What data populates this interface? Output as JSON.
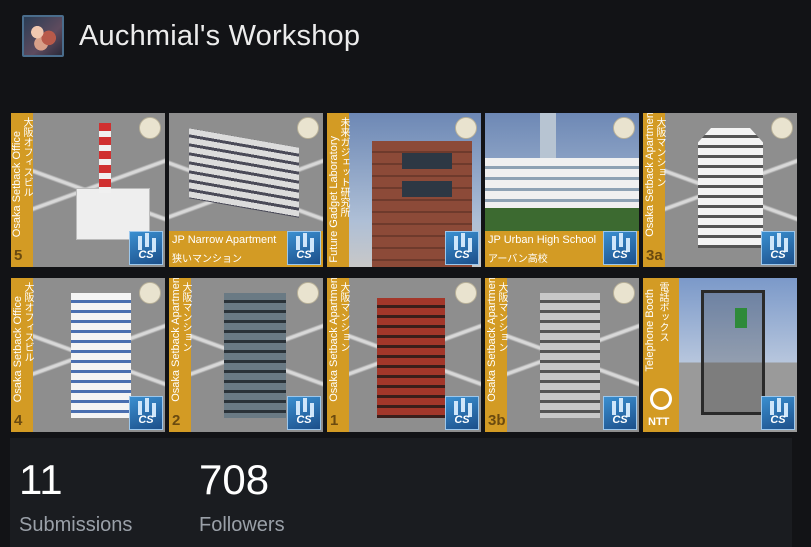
{
  "header": {
    "title": "Auchmial's Workshop"
  },
  "tiles": [
    {
      "vertical_en": "Osaka Setback Office",
      "vertical_jp": "大阪オフィスビル",
      "number": "5",
      "badge": "CS"
    },
    {
      "line1": "JP Narrow Apartment",
      "line2": "狭いマンション",
      "badge": "CS"
    },
    {
      "vertical_en": "Future Gadget Laboratory",
      "vertical_jp": "未来ガジェット研究所",
      "badge": "CS"
    },
    {
      "line1": "JP Urban High School",
      "line2": "アーバン高校",
      "badge": "CS"
    },
    {
      "vertical_en": "Osaka Setback Apartment",
      "vertical_jp": "大阪マンション",
      "number": "3a",
      "badge": "CS"
    },
    {
      "vertical_en": "Osaka Setback Office",
      "vertical_jp": "大阪オフィスビル",
      "number": "4",
      "badge": "CS"
    },
    {
      "vertical_en": "Osaka Setback Apartment",
      "vertical_jp": "大阪マンション",
      "number": "2",
      "badge": "CS"
    },
    {
      "vertical_en": "Osaka Setback Apartment",
      "vertical_jp": "大阪マンション",
      "number": "1",
      "badge": "CS"
    },
    {
      "vertical_en": "Osaka Setback Apartment",
      "vertical_jp": "大阪マンション",
      "number": "3b",
      "badge": "CS"
    },
    {
      "vertical_en": "Telephone Booth",
      "vertical_jp": "電話ボックス",
      "logo_text": "NTT",
      "badge": "CS"
    }
  ],
  "stats": {
    "submissions_value": "11",
    "submissions_label": "Submissions",
    "followers_value": "708",
    "followers_label": "Followers"
  }
}
